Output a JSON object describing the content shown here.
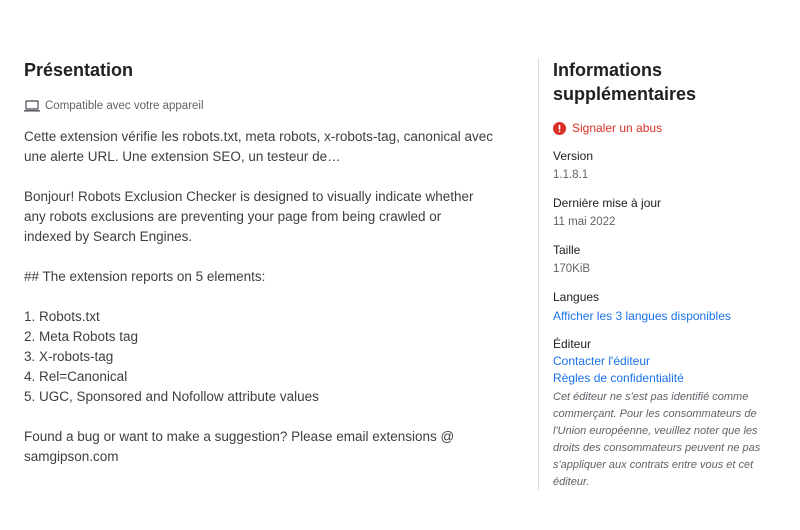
{
  "main": {
    "title": "Présentation",
    "compat_text": "Compatible avec votre appareil",
    "summary": "Cette extension vérifie les robots.txt, meta robots, x-robots-tag, canonical avec une alerte URL. Une extension SEO, un testeur de…",
    "description_lines": [
      "Bonjour! Robots Exclusion Checker is designed to visually indicate whether",
      "any robots exclusions are preventing your page from being crawled or",
      "indexed by Search Engines.",
      "",
      "## The extension reports on 5 elements:",
      "",
      "1. Robots.txt",
      "2. Meta Robots tag",
      "3. X-robots-tag",
      "4. Rel=Canonical",
      "5. UGC, Sponsored and Nofollow attribute values",
      "",
      "Found a bug or want to make a suggestion? Please email extensions @",
      "samgipson.com"
    ]
  },
  "side": {
    "title_line1": "Informations",
    "title_line2": "supplémentaires",
    "report_label": "Signaler un abus",
    "version_label": "Version",
    "version_value": "1.1.8.1",
    "updated_label": "Dernière mise à jour",
    "updated_value": "11 mai 2022",
    "size_label": "Taille",
    "size_value": "170KiB",
    "languages_label": "Langues",
    "languages_link": "Afficher les 3 langues disponibles",
    "publisher_label": "Éditeur",
    "contact_link": "Contacter l'éditeur",
    "privacy_link": "Règles de confidentialité",
    "notice": "Cet éditeur ne s'est pas identifié comme commerçant. Pour les consommateurs de l'Union européenne, veuillez noter que les droits des consommateurs peuvent ne pas s'appliquer aux contrats entre vous et cet éditeur."
  },
  "colors": {
    "report_red": "#d93025",
    "link_blue": "#1a73e8",
    "divider": "#dadce0"
  },
  "icons": {
    "compat": "laptop-icon",
    "report": "alert-circle-icon"
  }
}
